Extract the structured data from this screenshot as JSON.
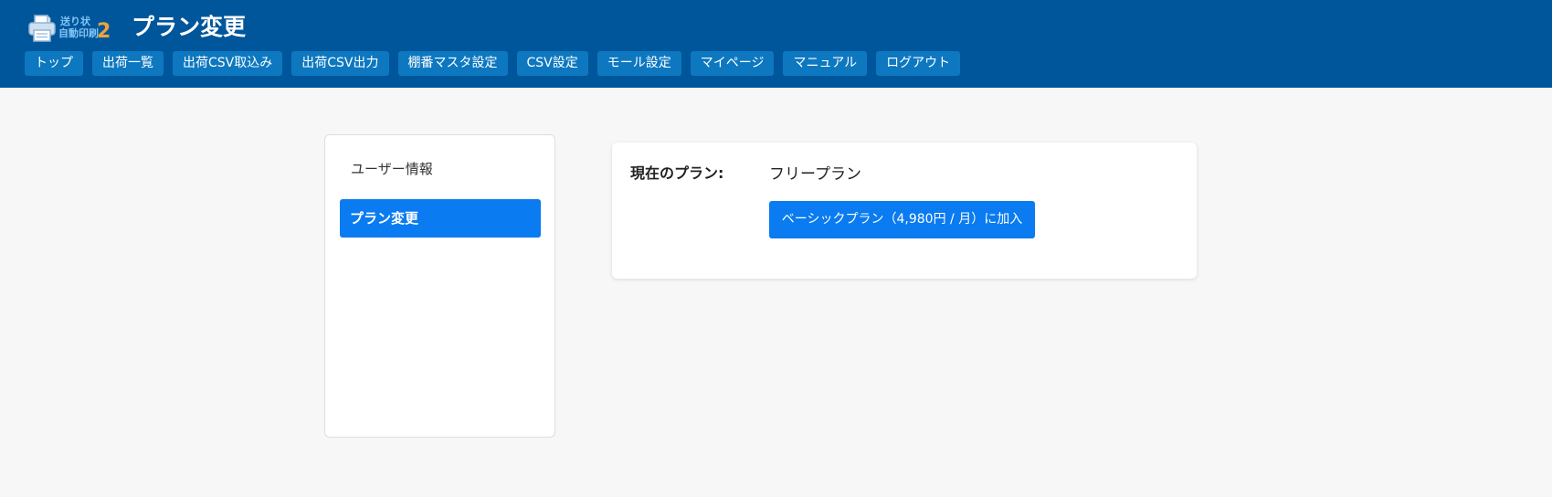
{
  "header": {
    "logo": {
      "line1": "送り状",
      "line2": "自動印刷",
      "number": "2",
      "icon": "printer-icon"
    },
    "page_title": "プラン変更"
  },
  "nav": {
    "items": [
      {
        "label": "トップ"
      },
      {
        "label": "出荷一覧"
      },
      {
        "label": "出荷CSV取込み"
      },
      {
        "label": "出荷CSV出力"
      },
      {
        "label": "棚番マスタ設定"
      },
      {
        "label": "CSV設定"
      },
      {
        "label": "モール設定"
      },
      {
        "label": "マイページ"
      },
      {
        "label": "マニュアル"
      },
      {
        "label": "ログアウト"
      }
    ]
  },
  "sidebar": {
    "items": [
      {
        "label": "ユーザー情報",
        "active": false
      },
      {
        "label": "プラン変更",
        "active": true
      }
    ]
  },
  "plan": {
    "current_label": "現在のプラン:",
    "current_value": "フリープラン",
    "join_button": "ベーシックプラン（4,980円 / 月）に加入"
  },
  "colors": {
    "header_bg": "#00569b",
    "nav_button_bg": "#0d78c0",
    "accent": "#0a7bf0",
    "logo_number": "#f0a33a",
    "page_bg": "#f7f7f7"
  }
}
